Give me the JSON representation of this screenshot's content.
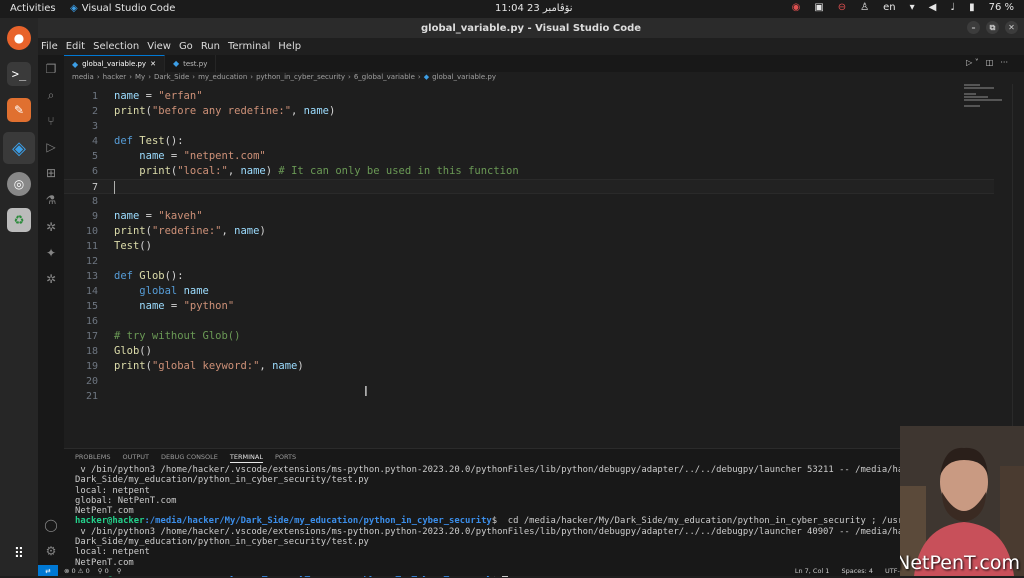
{
  "topbar": {
    "activities": "Activities",
    "app_name": "Visual Studio Code",
    "clock": "11:04  23 نۆڤامبر",
    "lang": "en",
    "battery": "76 %"
  },
  "window": {
    "title": "global_variable.py - Visual Studio Code"
  },
  "menu": [
    "File",
    "Edit",
    "Selection",
    "View",
    "Go",
    "Run",
    "Terminal",
    "Help"
  ],
  "tabs": [
    {
      "label": "global_variable.py",
      "active": true
    },
    {
      "label": "test.py",
      "active": false
    }
  ],
  "breadcrumb": [
    "media",
    "hacker",
    "My",
    "Dark_Side",
    "my_education",
    "python_in_cyber_security",
    "6_global_variable",
    "global_variable.py"
  ],
  "editor": {
    "current_line": 7,
    "lines": [
      "name = \"erfan\"",
      "print(\"before any redefine:\", name)",
      "",
      "def Test():",
      "    name = \"netpent.com\"",
      "    print(\"local:\", name) # It can only be used in this function",
      "",
      "",
      "name = \"kaveh\"",
      "print(\"redefine:\", name)",
      "Test()",
      "",
      "def Glob():",
      "    global name",
      "    name = \"python\"",
      "",
      "# try without Glob()",
      "Glob()",
      "print(\"global keyword:\", name)",
      "",
      ""
    ]
  },
  "panel": {
    "tabs": [
      "PROBLEMS",
      "OUTPUT",
      "DEBUG CONSOLE",
      "TERMINAL",
      "PORTS"
    ],
    "active_tab": "TERMINAL",
    "terminal": {
      "l1": " v /bin/python3 /home/hacker/.vscode/extensions/ms-python.python-2023.20.0/pythonFiles/lib/python/debugpy/adapter/../../debugpy/launcher 53211 -- /media/hac",
      "l2": "Dark_Side/my_education/python_in_cyber_security/test.py",
      "l3": "local: netpent",
      "l4": "global: NetPenT.com",
      "l5": "NetPenT.com",
      "user": "hacker@hacker",
      "path": ":/media/hacker/My/Dark_Side/my_education/python_in_cyber_security",
      "cmd": "$  cd /media/hacker/My/Dark_Side/my_education/python_in_cyber_security ; /usr",
      "l7": " v /bin/python3 /home/hacker/.vscode/extensions/ms-python.python-2023.20.0/pythonFiles/lib/python/debugpy/adapter/../../debugpy/launcher 40907 -- /media/hac",
      "l8": "Dark_Side/my_education/python_in_cyber_security/test.py",
      "l9": "local: netpent",
      "l10": "NetPenT.com",
      "prompt_end": "$ "
    }
  },
  "status": {
    "errors": "⊗ 0  ⚠ 0",
    "ports": "⚲ 0",
    "position": "Ln 7, Col 1",
    "spaces": "Spaces: 4",
    "encoding": "UTF-8"
  },
  "watermark": "NetPenT.com"
}
